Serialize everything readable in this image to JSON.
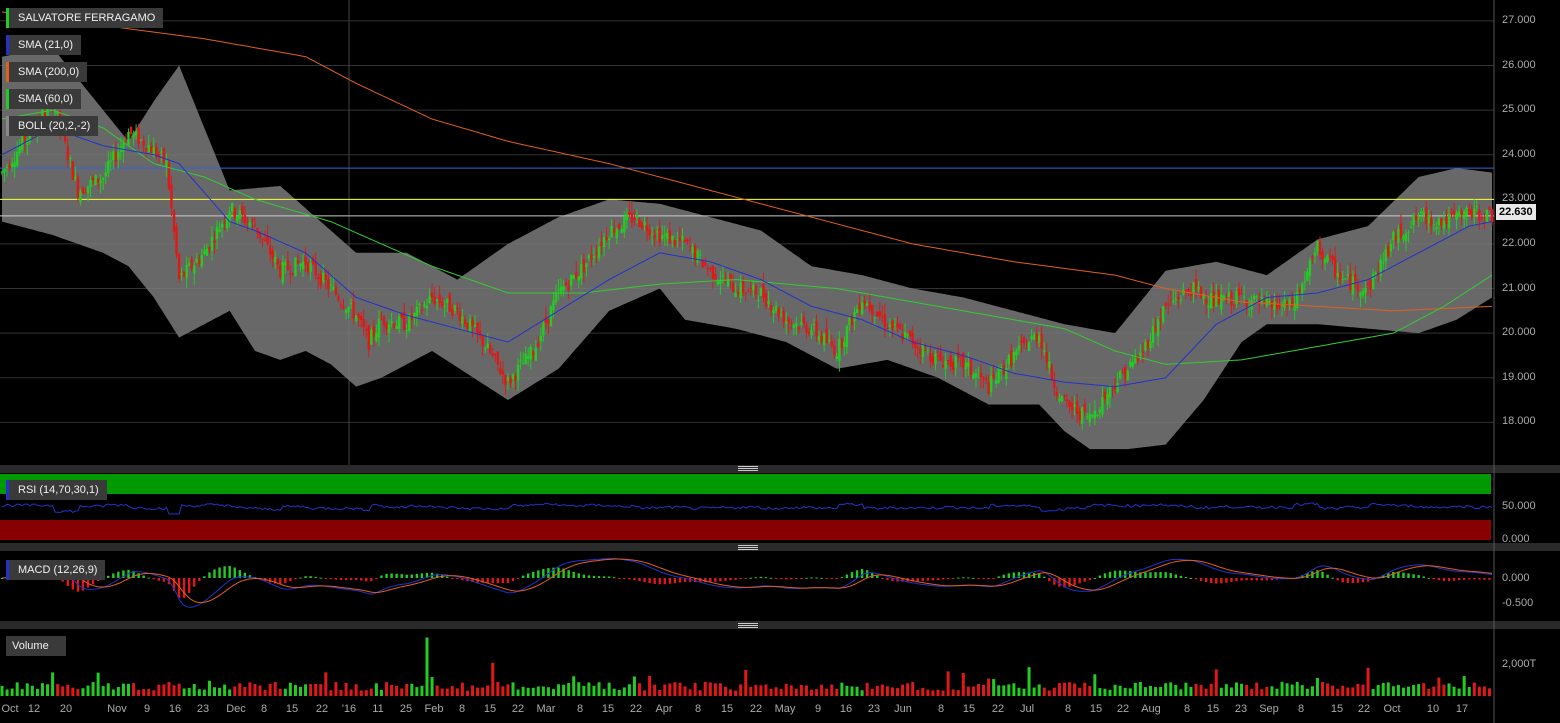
{
  "instrument": "SALVATORE FERRAGAMO",
  "legend": [
    {
      "label": "SALVATORE FERRAGAMO",
      "color": "#22cc22"
    },
    {
      "label": "SMA (21,0)",
      "color": "#2233cc"
    },
    {
      "label": "SMA (200,0)",
      "color": "#e06020"
    },
    {
      "label": "SMA (60,0)",
      "color": "#22cc22"
    },
    {
      "label": "BOLL (20,2,-2)",
      "color": "#888888"
    }
  ],
  "last_price": "22.630",
  "rsi_label": "RSI (14,70,30,1)",
  "macd_label": "MACD (12,26,9)",
  "volume_label": "Volume",
  "price_axis": [
    "27.000",
    "26.000",
    "25.000",
    "24.000",
    "23.000",
    "22.000",
    "21.000",
    "20.000",
    "19.000",
    "18.000"
  ],
  "rsi_axis": [
    "50.000",
    "0.000"
  ],
  "macd_axis": [
    "0.000",
    "-0.500"
  ],
  "volume_axis": [
    "2,000T"
  ],
  "date_labels": [
    "Oct",
    "12",
    "20",
    "Nov",
    "9",
    "16",
    "23",
    "Dec",
    "8",
    "15",
    "22",
    "'16",
    "11",
    "25",
    "Feb",
    "8",
    "15",
    "22",
    "Mar",
    "8",
    "15",
    "22",
    "Apr",
    "8",
    "15",
    "22",
    "May",
    "9",
    "16",
    "23",
    "Jun",
    "8",
    "15",
    "22",
    "Jul",
    "8",
    "15",
    "22",
    "Aug",
    "8",
    "15",
    "23",
    "Sep",
    "8",
    "15",
    "22",
    "Oct",
    "10",
    "17"
  ],
  "colors": {
    "up": "#22cc22",
    "down": "#e01818",
    "band": "#7a7a7a",
    "sma21": "#2233cc",
    "sma60": "#33cc33",
    "sma200": "#e06020",
    "hline_blue": "#3366dd",
    "hline_yellow": "#ffff33",
    "hline_white": "#cccccc",
    "rsi_line": "#2233cc",
    "rsi_over": "#009900",
    "rsi_under": "#880000",
    "macd_line": "#2233cc",
    "signal_line": "#e06020"
  },
  "chart_data": [
    {
      "type": "candlestick",
      "title": "SALVATORE FERRAGAMO",
      "x_range": [
        "2015-10",
        "2016-10-17"
      ],
      "ylim": [
        17.2,
        27.2
      ],
      "horizontal_levels": [
        23.7,
        23.0,
        22.63
      ],
      "anchors": {
        "close": [
          [
            0,
            23.6
          ],
          [
            10,
            24.4
          ],
          [
            20,
            25.2
          ],
          [
            30,
            23.2
          ],
          [
            40,
            23.5
          ],
          [
            50,
            24.5
          ],
          [
            58,
            24.2
          ],
          [
            65,
            23.8
          ],
          [
            70,
            21.2
          ],
          [
            80,
            21.8
          ],
          [
            90,
            22.8
          ],
          [
            100,
            22.4
          ],
          [
            110,
            21.4
          ],
          [
            120,
            21.6
          ],
          [
            130,
            21.0
          ],
          [
            140,
            20.4
          ],
          [
            145,
            19.8
          ],
          [
            150,
            20.3
          ],
          [
            160,
            20.2
          ],
          [
            170,
            20.8
          ],
          [
            180,
            20.5
          ],
          [
            190,
            19.8
          ],
          [
            200,
            18.9
          ],
          [
            210,
            19.6
          ],
          [
            220,
            20.9
          ],
          [
            230,
            21.5
          ],
          [
            240,
            22.3
          ],
          [
            250,
            22.6
          ],
          [
            260,
            22.2
          ],
          [
            270,
            22.0
          ],
          [
            280,
            21.4
          ],
          [
            290,
            21.0
          ],
          [
            300,
            20.9
          ],
          [
            310,
            20.3
          ],
          [
            320,
            20.1
          ],
          [
            330,
            19.6
          ],
          [
            340,
            20.8
          ],
          [
            350,
            20.2
          ],
          [
            360,
            19.8
          ],
          [
            370,
            19.4
          ],
          [
            380,
            19.3
          ],
          [
            390,
            18.8
          ],
          [
            400,
            19.5
          ],
          [
            410,
            20.0
          ],
          [
            415,
            19.0
          ],
          [
            420,
            18.4
          ],
          [
            430,
            18.1
          ],
          [
            440,
            18.9
          ],
          [
            450,
            19.5
          ],
          [
            460,
            20.6
          ],
          [
            470,
            21.0
          ],
          [
            480,
            20.7
          ],
          [
            490,
            20.8
          ],
          [
            500,
            20.6
          ],
          [
            510,
            20.6
          ],
          [
            515,
            21.2
          ],
          [
            520,
            21.9
          ],
          [
            530,
            21.2
          ],
          [
            540,
            21.0
          ],
          [
            550,
            22.1
          ],
          [
            560,
            22.6
          ],
          [
            570,
            22.5
          ],
          [
            580,
            22.7
          ],
          [
            589,
            22.63
          ]
        ],
        "bb_upper": [
          [
            0,
            26.2
          ],
          [
            20,
            26.4
          ],
          [
            50,
            24.3
          ],
          [
            60,
            25.2
          ],
          [
            70,
            26.0
          ],
          [
            80,
            24.6
          ],
          [
            90,
            23.2
          ],
          [
            110,
            23.3
          ],
          [
            130,
            22.3
          ],
          [
            140,
            21.8
          ],
          [
            160,
            21.8
          ],
          [
            180,
            21.2
          ],
          [
            200,
            22.0
          ],
          [
            220,
            22.6
          ],
          [
            240,
            23.0
          ],
          [
            260,
            22.9
          ],
          [
            280,
            22.6
          ],
          [
            300,
            22.3
          ],
          [
            320,
            21.5
          ],
          [
            340,
            21.3
          ],
          [
            360,
            21.0
          ],
          [
            380,
            20.8
          ],
          [
            400,
            20.5
          ],
          [
            420,
            20.2
          ],
          [
            440,
            20.0
          ],
          [
            460,
            21.4
          ],
          [
            480,
            21.6
          ],
          [
            500,
            21.3
          ],
          [
            520,
            22.1
          ],
          [
            540,
            22.4
          ],
          [
            560,
            23.5
          ],
          [
            575,
            23.7
          ],
          [
            589,
            23.6
          ]
        ],
        "bb_lower": [
          [
            0,
            22.5
          ],
          [
            20,
            22.2
          ],
          [
            40,
            21.8
          ],
          [
            50,
            21.5
          ],
          [
            60,
            20.8
          ],
          [
            70,
            19.9
          ],
          [
            80,
            20.2
          ],
          [
            90,
            20.5
          ],
          [
            100,
            19.6
          ],
          [
            110,
            19.4
          ],
          [
            120,
            19.6
          ],
          [
            130,
            19.3
          ],
          [
            140,
            18.8
          ],
          [
            150,
            19.0
          ],
          [
            170,
            19.6
          ],
          [
            200,
            18.5
          ],
          [
            220,
            19.2
          ],
          [
            240,
            20.5
          ],
          [
            260,
            21.0
          ],
          [
            270,
            20.3
          ],
          [
            290,
            20.1
          ],
          [
            310,
            19.8
          ],
          [
            330,
            19.2
          ],
          [
            350,
            19.4
          ],
          [
            370,
            19.0
          ],
          [
            390,
            18.4
          ],
          [
            410,
            18.4
          ],
          [
            420,
            17.8
          ],
          [
            430,
            17.4
          ],
          [
            445,
            17.4
          ],
          [
            460,
            17.5
          ],
          [
            475,
            18.5
          ],
          [
            490,
            19.8
          ],
          [
            500,
            20.2
          ],
          [
            520,
            20.2
          ],
          [
            540,
            20.1
          ],
          [
            560,
            20.0
          ],
          [
            575,
            20.3
          ],
          [
            589,
            20.8
          ]
        ],
        "sma21": [
          [
            0,
            24.0
          ],
          [
            20,
            24.6
          ],
          [
            40,
            24.2
          ],
          [
            60,
            24.0
          ],
          [
            70,
            23.8
          ],
          [
            90,
            22.5
          ],
          [
            100,
            22.3
          ],
          [
            120,
            21.8
          ],
          [
            140,
            20.8
          ],
          [
            160,
            20.4
          ],
          [
            180,
            20.1
          ],
          [
            200,
            19.8
          ],
          [
            220,
            20.5
          ],
          [
            240,
            21.2
          ],
          [
            260,
            21.8
          ],
          [
            280,
            21.6
          ],
          [
            300,
            21.2
          ],
          [
            320,
            20.6
          ],
          [
            340,
            20.3
          ],
          [
            360,
            19.8
          ],
          [
            380,
            19.5
          ],
          [
            400,
            19.1
          ],
          [
            420,
            18.9
          ],
          [
            440,
            18.8
          ],
          [
            460,
            19.0
          ],
          [
            480,
            20.2
          ],
          [
            500,
            20.8
          ],
          [
            520,
            20.9
          ],
          [
            540,
            21.2
          ],
          [
            560,
            21.8
          ],
          [
            580,
            22.4
          ],
          [
            589,
            22.5
          ]
        ],
        "sma60": [
          [
            0,
            24.8
          ],
          [
            20,
            25.0
          ],
          [
            40,
            24.6
          ],
          [
            60,
            23.8
          ],
          [
            80,
            23.5
          ],
          [
            100,
            23.0
          ],
          [
            130,
            22.5
          ],
          [
            150,
            22.0
          ],
          [
            170,
            21.5
          ],
          [
            200,
            20.9
          ],
          [
            230,
            20.9
          ],
          [
            260,
            21.1
          ],
          [
            290,
            21.2
          ],
          [
            330,
            21.0
          ],
          [
            360,
            20.7
          ],
          [
            390,
            20.4
          ],
          [
            420,
            20.1
          ],
          [
            440,
            19.6
          ],
          [
            460,
            19.3
          ],
          [
            490,
            19.4
          ],
          [
            520,
            19.7
          ],
          [
            550,
            20.0
          ],
          [
            570,
            20.6
          ],
          [
            589,
            21.3
          ]
        ],
        "sma200": [
          [
            0,
            27.2
          ],
          [
            40,
            26.9
          ],
          [
            80,
            26.6
          ],
          [
            120,
            26.2
          ],
          [
            140,
            25.6
          ],
          [
            170,
            24.8
          ],
          [
            200,
            24.3
          ],
          [
            240,
            23.8
          ],
          [
            280,
            23.2
          ],
          [
            320,
            22.6
          ],
          [
            360,
            22.0
          ],
          [
            400,
            21.6
          ],
          [
            440,
            21.3
          ],
          [
            460,
            21.0
          ],
          [
            490,
            20.7
          ],
          [
            520,
            20.6
          ],
          [
            550,
            20.5
          ],
          [
            589,
            20.6
          ]
        ]
      }
    },
    {
      "type": "line",
      "title": "RSI (14,70,30,1)",
      "ylim": [
        0,
        100
      ],
      "overbought": 70,
      "oversold": 30
    },
    {
      "type": "bar",
      "title": "MACD (12,26,9)",
      "ylim": [
        -0.8,
        0.5
      ]
    },
    {
      "type": "bar",
      "title": "Volume",
      "ylim": [
        0,
        3500
      ],
      "unit": "T"
    }
  ]
}
